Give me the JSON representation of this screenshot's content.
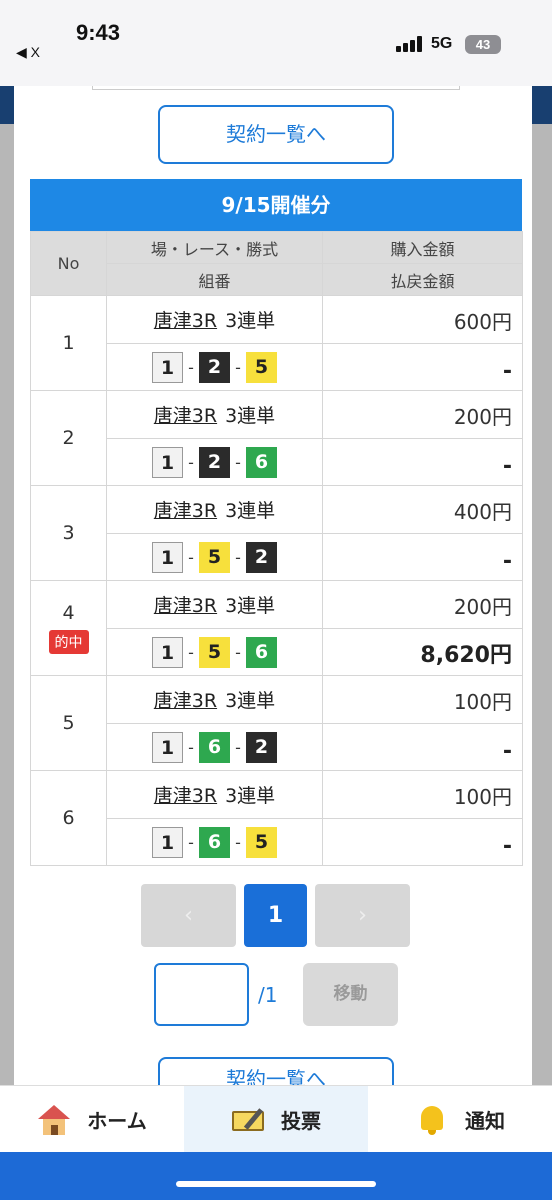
{
  "status_bar": {
    "time": "9:43",
    "back_label": "◀ X",
    "network": "5G",
    "battery": "43"
  },
  "top_button": "契約一覧へ",
  "bottom_button": "契約一覧へ",
  "date_header": "9/15開催分",
  "table": {
    "headers": {
      "no": "No",
      "race_header": "場・レース・勝式",
      "combo_header": "組番",
      "amount_header": "購入金額",
      "payout_header": "払戻金額"
    },
    "hit_label": "的中",
    "rows": [
      {
        "no": "1",
        "race": "唐津3R",
        "bet_type": "3連単",
        "combo": [
          "1",
          "2",
          "5"
        ],
        "amount": "600円",
        "payout": "-",
        "hit": false
      },
      {
        "no": "2",
        "race": "唐津3R",
        "bet_type": "3連単",
        "combo": [
          "1",
          "2",
          "6"
        ],
        "amount": "200円",
        "payout": "-",
        "hit": false
      },
      {
        "no": "3",
        "race": "唐津3R",
        "bet_type": "3連単",
        "combo": [
          "1",
          "5",
          "2"
        ],
        "amount": "400円",
        "payout": "-",
        "hit": false
      },
      {
        "no": "4",
        "race": "唐津3R",
        "bet_type": "3連単",
        "combo": [
          "1",
          "5",
          "6"
        ],
        "amount": "200円",
        "payout": "8,620円",
        "hit": true
      },
      {
        "no": "5",
        "race": "唐津3R",
        "bet_type": "3連単",
        "combo": [
          "1",
          "6",
          "2"
        ],
        "amount": "100円",
        "payout": "-",
        "hit": false
      },
      {
        "no": "6",
        "race": "唐津3R",
        "bet_type": "3連単",
        "combo": [
          "1",
          "6",
          "5"
        ],
        "amount": "100円",
        "payout": "-",
        "hit": false
      }
    ]
  },
  "pagination": {
    "prev_icon": "‹",
    "current": "1",
    "next_icon": "›",
    "input_value": "",
    "total": "/1",
    "move_label": "移動"
  },
  "nav": {
    "home": "ホーム",
    "vote": "投票",
    "notice": "通知"
  },
  "colors": {
    "accent": "#1e88e5",
    "hit": "#e53935",
    "chip_1": "#f2f2f2",
    "chip_2": "#2b2b2b",
    "chip_5": "#f7e03c",
    "chip_6": "#2ea84f"
  }
}
